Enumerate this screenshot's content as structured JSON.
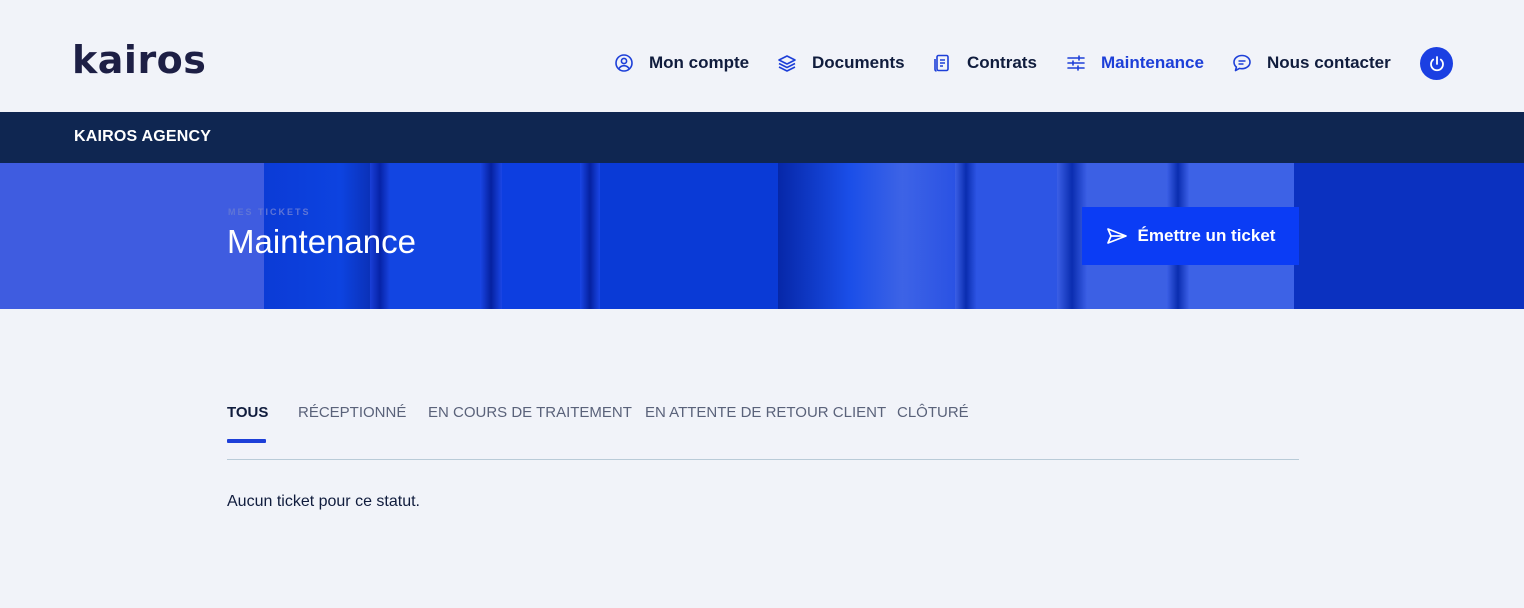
{
  "brand": {
    "logo_text": "kairos"
  },
  "nav": {
    "items": [
      {
        "label": "Mon compte",
        "icon": "user-circle-icon",
        "active": false
      },
      {
        "label": "Documents",
        "icon": "layers-icon",
        "active": false
      },
      {
        "label": "Contrats",
        "icon": "contract-icon",
        "active": false
      },
      {
        "label": "Maintenance",
        "icon": "sliders-icon",
        "active": true
      },
      {
        "label": "Nous contacter",
        "icon": "chat-bubble-icon",
        "active": false
      }
    ],
    "logout_icon": "power-icon"
  },
  "agency": {
    "name": "KAIROS AGENCY"
  },
  "hero": {
    "eyebrow": "MES TICKETS",
    "title": "Maintenance",
    "cta_label": "Émettre un ticket",
    "cta_icon": "send-icon"
  },
  "tabs": [
    {
      "label": "TOUS",
      "active": true
    },
    {
      "label": "RÉCEPTIONNÉ",
      "active": false
    },
    {
      "label": "EN COURS DE TRAITEMENT",
      "active": false
    },
    {
      "label": "EN ATTENTE DE RETOUR CLIENT",
      "active": false
    },
    {
      "label": "CLÔTURÉ",
      "active": false
    }
  ],
  "empty_state": {
    "message": "Aucun ticket pour ce statut."
  },
  "colors": {
    "accent": "#1d3fd8",
    "navy": "#0f2651",
    "cta": "#0b3cf5",
    "background": "#f1f3f9"
  }
}
